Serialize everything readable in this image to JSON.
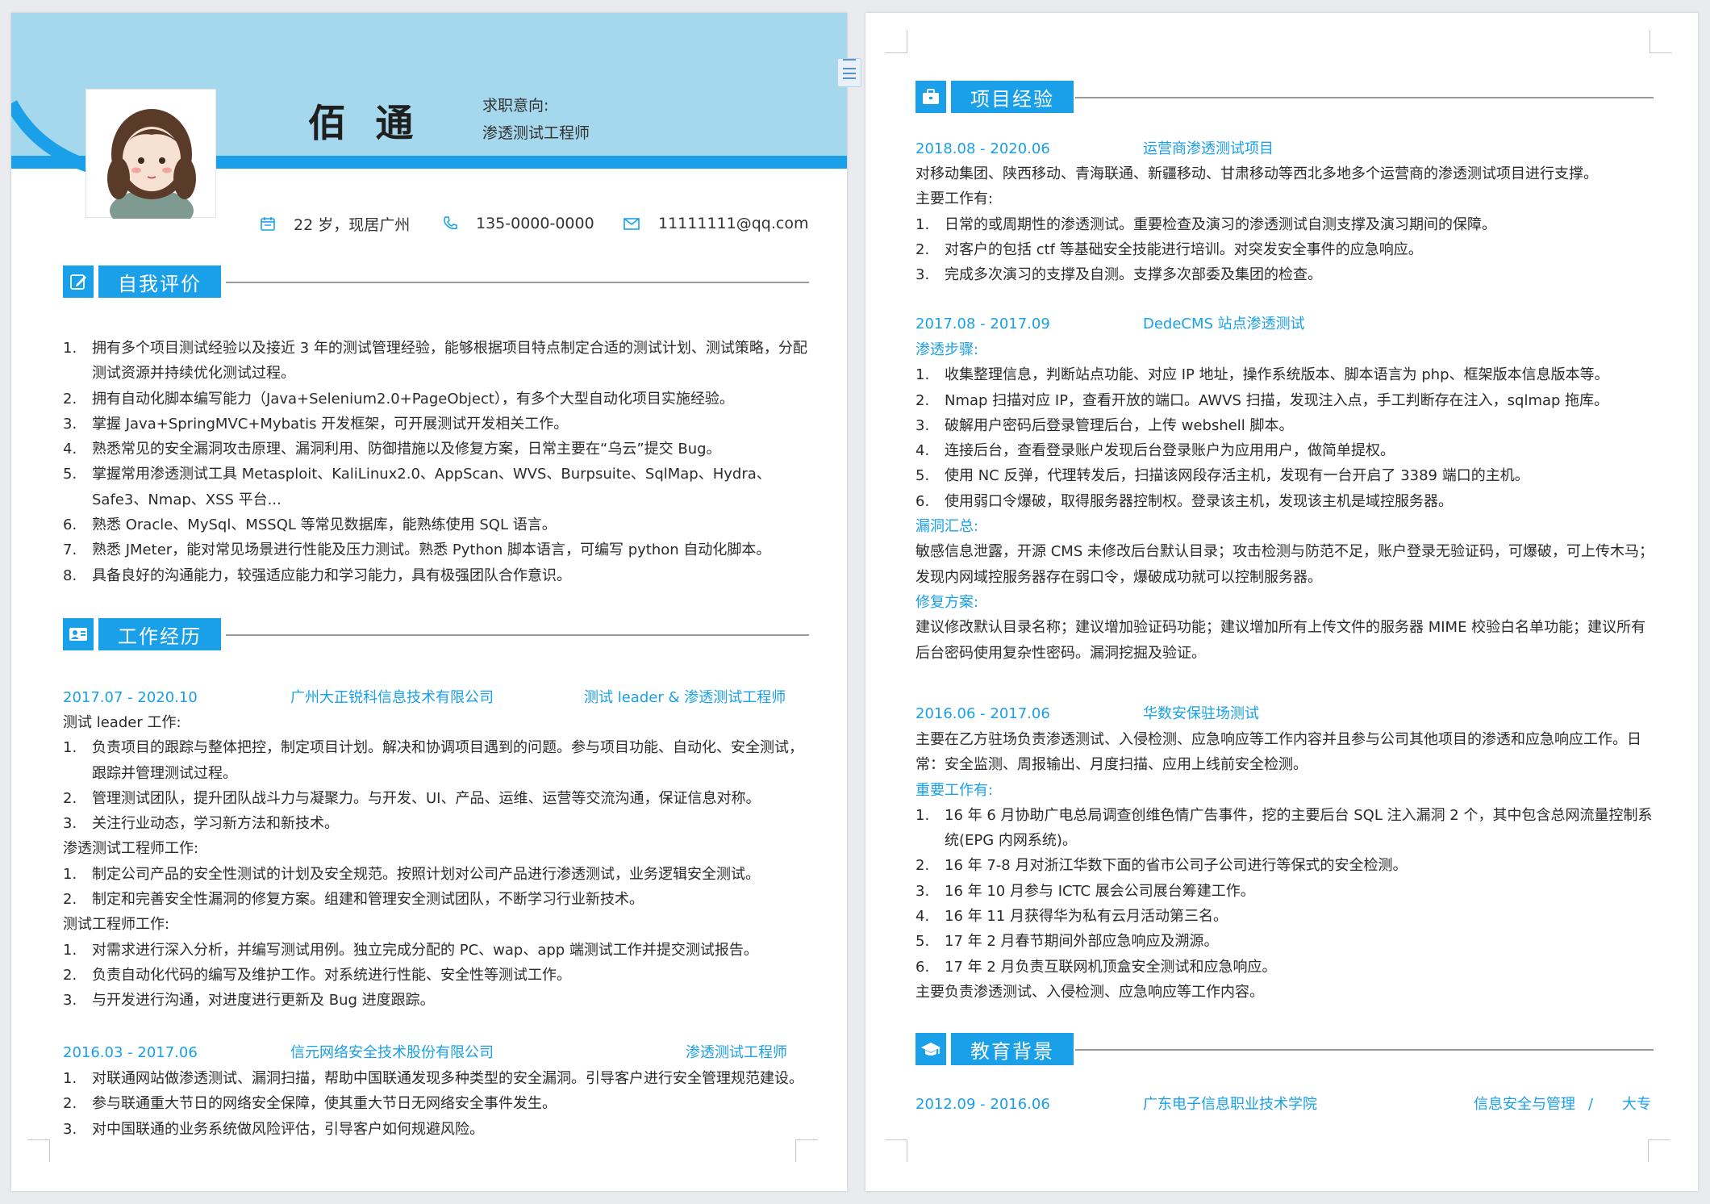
{
  "header": {
    "name": "佰 通",
    "intent_label": "求职意向:",
    "intent_value": "渗透测试工程师",
    "age_location": "22 岁，现居广州",
    "phone": "135-0000-0000",
    "email": "11111111@qq.com"
  },
  "colors": {
    "accent": "#1aa0e8",
    "band": "#a5d7ed"
  },
  "self_eval": {
    "title": "自我评价",
    "icon": "edit-icon",
    "items": [
      {
        "num": "1.",
        "text": "拥有多个项目测试经验以及接近 3 年的测试管理经验，能够根据项目特点制定合适的测试计划、测试策略，分配测试资源并持续优化测试过程。"
      },
      {
        "num": "2.",
        "text": "拥有自动化脚本编写能力（Java+Selenium2.0+PageObject），有多个大型自动化项目实施经验。"
      },
      {
        "num": "3.",
        "text": "掌握 Java+SpringMVC+Mybatis 开发框架，可开展测试开发相关工作。"
      },
      {
        "num": "4.",
        "text": "熟悉常见的安全漏洞攻击原理、漏洞利用、防御措施以及修复方案，日常主要在“乌云”提交 Bug。"
      },
      {
        "num": "5.",
        "text": "掌握常用渗透测试工具 Metasploit、KaliLinux2.0、AppScan、WVS、Burpsuite、SqlMap、Hydra、Safe3、Nmap、XSS 平台..."
      },
      {
        "num": "6.",
        "text": "熟悉 Oracle、MySql、MSSQL 等常见数据库，能熟练使用 SQL 语言。"
      },
      {
        "num": "7.",
        "text": "熟悉 JMeter，能对常见场景进行性能及压力测试。熟悉 Python 脚本语言，可编写 python 自动化脚本。"
      },
      {
        "num": "8.",
        "text": "具备良好的沟通能力，较强适应能力和学习能力，具有极强团队合作意识。"
      }
    ]
  },
  "work": {
    "title": "工作经历",
    "icon": "id-card-icon",
    "jobs": [
      {
        "period": "2017.07 - 2020.10",
        "company": "广州大正锐科信息技术有限公司",
        "role": "测试 leader &  渗透测试工程师",
        "groups": [
          {
            "label": "测试 leader 工作:",
            "items": [
              {
                "num": "1.",
                "text": "负责项目的跟踪与整体把控，制定项目计划。解决和协调项目遇到的问题。参与项目功能、自动化、安全测试，跟踪并管理测试过程。"
              },
              {
                "num": "2.",
                "text": "管理测试团队，提升团队战斗力与凝聚力。与开发、UI、产品、运维、运营等交流沟通，保证信息对称。"
              },
              {
                "num": "3.",
                "text": "关注行业动态，学习新方法和新技术。"
              }
            ]
          },
          {
            "label": "渗透测试工程师工作:",
            "items": [
              {
                "num": "1.",
                "text": "制定公司产品的安全性测试的计划及安全规范。按照计划对公司产品进行渗透测试，业务逻辑安全测试。"
              },
              {
                "num": "2.",
                "text": "制定和完善安全性漏洞的修复方案。组建和管理安全测试团队，不断学习行业新技术。"
              }
            ]
          },
          {
            "label": "测试工程师工作:",
            "items": [
              {
                "num": "1.",
                "text": "对需求进行深入分析，并编写测试用例。独立完成分配的 PC、wap、app 端测试工作并提交测试报告。"
              },
              {
                "num": "2.",
                "text": "负责自动化代码的编写及维护工作。对系统进行性能、安全性等测试工作。"
              },
              {
                "num": "3.",
                "text": "与开发进行沟通，对进度进行更新及 Bug 进度跟踪。"
              }
            ]
          }
        ]
      },
      {
        "period": "2016.03 - 2017.06",
        "company": "信元网络安全技术股份有限公司",
        "role": "渗透测试工程师",
        "items": [
          {
            "num": "1.",
            "text": "对联通网站做渗透测试、漏洞扫描，帮助中国联通发现多种类型的安全漏洞。引导客户进行安全管理规范建设。"
          },
          {
            "num": "2.",
            "text": "参与联通重大节日的网络安全保障，使其重大节日无网络安全事件发生。"
          },
          {
            "num": "3.",
            "text": "对中国联通的业务系统做风险评估，引导客户如何规避风险。"
          }
        ]
      }
    ]
  },
  "projects": {
    "title": "项目经验",
    "icon": "briefcase-icon",
    "p1": {
      "period": "2018.08 - 2020.06",
      "name": "运营商渗透测试项目",
      "desc": "对移动集团、陕西移动、青海联通、新疆移动、甘肃移动等西北多地多个运营商的渗透测试项目进行支撑。",
      "label": "主要工作有:",
      "items": [
        {
          "num": "1.",
          "text": "日常的或周期性的渗透测试。重要检查及演习的渗透测试自测支撑及演习期间的保障。"
        },
        {
          "num": "2.",
          "text": "对客户的包括 ctf 等基础安全技能进行培训。对突发安全事件的应急响应。"
        },
        {
          "num": "3.",
          "text": "完成多次演习的支撑及自测。支撑多次部委及集团的检查。"
        }
      ]
    },
    "p2": {
      "period": "2017.08 - 2017.09",
      "name": "DedeCMS 站点渗透测试",
      "steps_label": "渗透步骤:",
      "steps": [
        {
          "num": "1.",
          "text": "收集整理信息，判断站点功能、对应 IP 地址，操作系统版本、脚本语言为 php、框架版本信息版本等。"
        },
        {
          "num": "2.",
          "text": "Nmap 扫描对应 IP，查看开放的端口。AWVS 扫描，发现注入点，手工判断存在注入，sqlmap 拖库。"
        },
        {
          "num": "3.",
          "text": "破解用户密码后登录管理后台，上传 webshell 脚本。"
        },
        {
          "num": "4.",
          "text": "连接后台，查看登录账户发现后台登录账户为应用用户，做简单提权。"
        },
        {
          "num": "5.",
          "text": "使用 NC 反弹，代理转发后，扫描该网段存活主机，发现有一台开启了 3389 端口的主机。"
        },
        {
          "num": "6.",
          "text": "使用弱口令爆破，取得服务器控制权。登录该主机，发现该主机是域控服务器。"
        }
      ],
      "vuln_label": "漏洞汇总:",
      "vuln_text": "敏感信息泄露，开源 CMS 未修改后台默认目录；攻击检测与防范不足，账户登录无验证码，可爆破，可上传木马；发现内网域控服务器存在弱口令，爆破成功就可以控制服务器。",
      "fix_label": "修复方案:",
      "fix_text": "建议修改默认目录名称；建议增加验证码功能；建议增加所有上传文件的服务器 MIME 校验白名单功能；建议所有后台密码使用复杂性密码。漏洞挖掘及验证。"
    },
    "p3": {
      "period": "2016.06 - 2017.06",
      "name": "华数安保驻场测试",
      "desc": "主要在乙方驻场负责渗透测试、入侵检测、应急响应等工作内容并且参与公司其他项目的渗透和应急响应工作。日常：安全监测、周报输出、月度扫描、应用上线前安全检测。",
      "label": "重要工作有:",
      "items": [
        {
          "num": "1.",
          "text": "16 年 6 月协助广电总局调查创维色情广告事件，挖的主要后台 SQL 注入漏洞 2 个，其中包含总网流量控制系统(EPG 内网系统)。"
        },
        {
          "num": "2.",
          "text": "16 年 7-8 月对浙江华数下面的省市公司子公司进行等保式的安全检测。"
        },
        {
          "num": "3.",
          "text": "16 年 10 月参与 ICTC 展会公司展台筹建工作。"
        },
        {
          "num": "4.",
          "text": "16 年 11 月获得华为私有云月活动第三名。"
        },
        {
          "num": "5.",
          "text": "17 年 2 月春节期间外部应急响应及溯源。"
        },
        {
          "num": "6.",
          "text": "17 年 2 月负责互联网机顶盒安全测试和应急响应。"
        }
      ],
      "footer": "主要负责渗透测试、入侵检测、应急响应等工作内容。"
    }
  },
  "education": {
    "title": "教育背景",
    "icon": "graduation-cap-icon",
    "period": "2012.09 - 2016.06",
    "school": "广东电子信息职业技术学院",
    "major": "信息安全与管理",
    "sep": "/",
    "degree": "大专"
  }
}
